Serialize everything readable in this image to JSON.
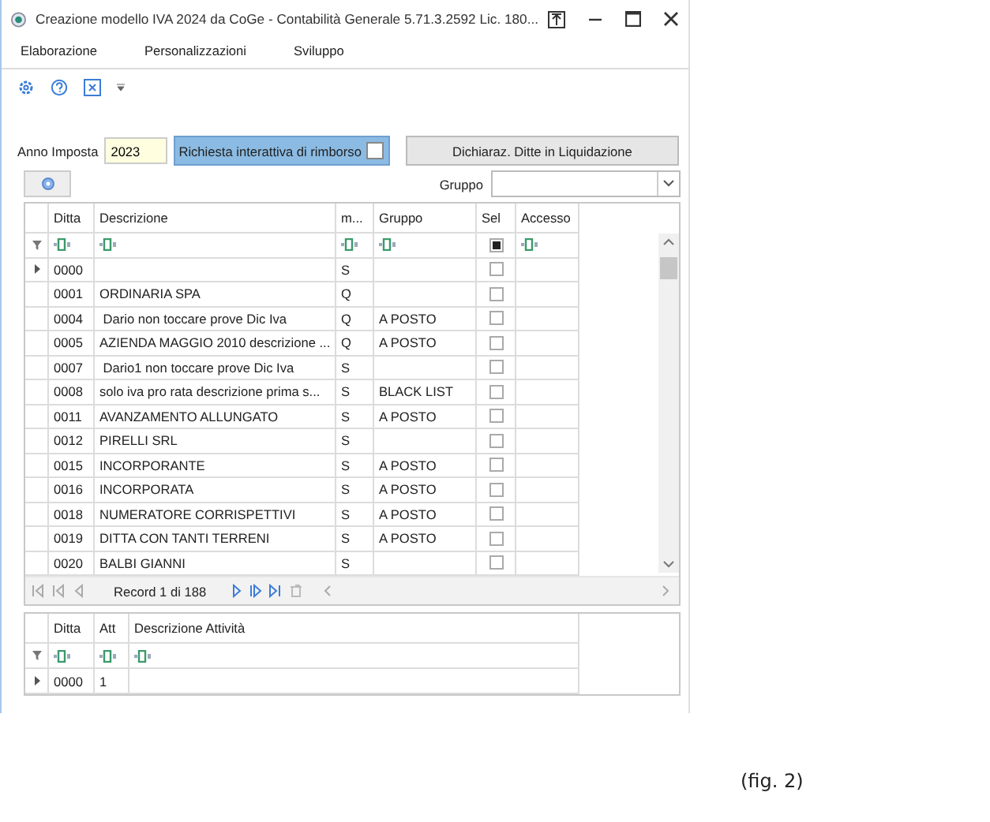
{
  "window": {
    "title": "Creazione modello IVA 2024 da CoGe - Contabilità Generale 5.71.3.2592 Lic. 180..."
  },
  "menu": [
    {
      "label": "Elaborazione"
    },
    {
      "label": "Personalizzazioni"
    },
    {
      "label": "Sviluppo"
    }
  ],
  "params": {
    "anno_label": "Anno Imposta",
    "anno_value": "2023",
    "rimborso_label": "Richiesta interattiva di rimborso",
    "rimborso_checked": false,
    "button": "Dichiaraz. Ditte in Liquidazione"
  },
  "gruppo": {
    "label": "Gruppo"
  },
  "grid": {
    "columns": [
      "Ditta",
      "Descrizione",
      "m...",
      "Gruppo",
      "Sel",
      "Accesso"
    ],
    "sel_filter_checked": true,
    "rows": [
      {
        "ditta": "0000",
        "descrizione": "",
        "m": "S",
        "gruppo": "",
        "sel": false,
        "current": true
      },
      {
        "ditta": "0001",
        "descrizione": "ORDINARIA SPA",
        "m": "Q",
        "gruppo": "",
        "sel": false,
        "current": false
      },
      {
        "ditta": "0004",
        "descrizione": " Dario non toccare prove Dic Iva",
        "m": "Q",
        "gruppo": "A POSTO",
        "sel": false,
        "current": false
      },
      {
        "ditta": "0005",
        "descrizione": "AZIENDA MAGGIO 2010 descrizione ...",
        "m": "Q",
        "gruppo": "A POSTO",
        "sel": false,
        "current": false
      },
      {
        "ditta": "0007",
        "descrizione": " Dario1 non toccare prove Dic Iva",
        "m": "S",
        "gruppo": "",
        "sel": false,
        "current": false
      },
      {
        "ditta": "0008",
        "descrizione": "solo iva pro rata descrizione prima s...",
        "m": "S",
        "gruppo": "BLACK LIST",
        "sel": false,
        "current": false
      },
      {
        "ditta": "0011",
        "descrizione": "AVANZAMENTO ALLUNGATO",
        "m": "S",
        "gruppo": "A POSTO",
        "sel": false,
        "current": false
      },
      {
        "ditta": "0012",
        "descrizione": "PIRELLI SRL",
        "m": "S",
        "gruppo": "",
        "sel": false,
        "current": false
      },
      {
        "ditta": "0015",
        "descrizione": "INCORPORANTE",
        "m": "S",
        "gruppo": "A POSTO",
        "sel": false,
        "current": false
      },
      {
        "ditta": "0016",
        "descrizione": "INCORPORATA",
        "m": "S",
        "gruppo": "A POSTO",
        "sel": false,
        "current": false
      },
      {
        "ditta": "0018",
        "descrizione": "NUMERATORE CORRISPETTIVI",
        "m": "S",
        "gruppo": "A POSTO",
        "sel": false,
        "current": false
      },
      {
        "ditta": "0019",
        "descrizione": "DITTA CON TANTI TERRENI",
        "m": "S",
        "gruppo": "A POSTO",
        "sel": false,
        "current": false
      },
      {
        "ditta": "0020",
        "descrizione": "BALBI GIANNI",
        "m": "S",
        "gruppo": "",
        "sel": false,
        "current": false
      }
    ],
    "record": "Record 1 di 188"
  },
  "sub_grid": {
    "columns": [
      "Ditta",
      "Att",
      "Descrizione Attività"
    ],
    "rows": [
      {
        "ditta": "0000",
        "att": "1",
        "descrizione": "",
        "current": true
      }
    ]
  },
  "caption": "(fig. 2)"
}
